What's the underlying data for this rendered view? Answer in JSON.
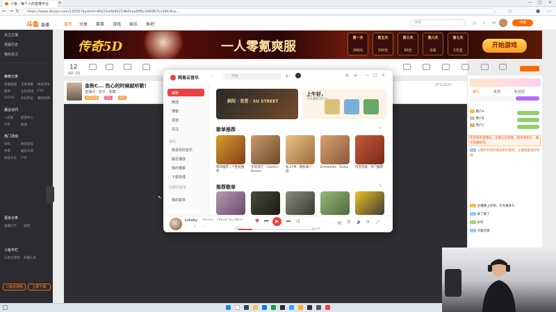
{
  "browser": {
    "tab_title": "斗鱼 - 每个人的直播平台",
    "url": "https://www.douyu.com/12055?dyshid=40d15e0b90214b0cea5ff5c3d00671c3dfc9ca..."
  },
  "site": {
    "logo": "斗鱼",
    "logo_sub": "直播",
    "nav": [
      "首页",
      "分类",
      "赛事",
      "游戏",
      "娱乐",
      "鱼吧"
    ],
    "search_placeholder": "搜索",
    "open_live": "开播"
  },
  "sidebar": {
    "top_items": [
      "关注主播",
      "观看历史",
      "我的关注"
    ],
    "sections": [
      {
        "title": "推荐分类",
        "items": [
          "英雄联盟",
          "王者荣耀",
          "绝地求生",
          "原神",
          "主机游戏",
          "CS2",
          "DOTA2",
          "炉石传说",
          "我的世界"
        ]
      },
      {
        "title": "最近访问",
        "items": [
          "一起看",
          "新游中心",
          "户外",
          "颜值"
        ]
      },
      {
        "title": "热门活动",
        "items": [
          "单机",
          "网游竞技",
          "手游",
          "娱乐天地",
          "科技文化",
          "户外"
        ]
      },
      {
        "title": "更多分类",
        "items": [
          "直播大厅",
          "鱼吧"
        ]
      },
      {
        "title": "斗鱼专栏",
        "items": [
          "斗鱼云游戏",
          "开播工具"
        ]
      }
    ],
    "bottom_left": "斗鱼云游戏",
    "bottom_right": "立即下载"
  },
  "banner": {
    "left_text": "传奇5D",
    "center_text": "一人零氪爽服",
    "days": [
      {
        "day": "第一天",
        "reward": "200元"
      },
      {
        "day": "第五天",
        "reward": "330元"
      },
      {
        "day": "第三天",
        "reward": "50元"
      },
      {
        "day": "第六天",
        "reward": "马车"
      },
      {
        "day": "第七天",
        "reward": "1元宝"
      }
    ],
    "cta": "开始游戏"
  },
  "catrow": {
    "date": "12",
    "date_label": "周四 日签"
  },
  "stream": {
    "title": "金秋C... 伤心的时候就听歌！",
    "streamer": "直播间 · 音乐 · 收藏",
    "tags": [
      "新秀主播",
      "音乐",
      "情感"
    ],
    "viewer_count": "272/1027"
  },
  "right_panel": {
    "tabs": [
      "排行",
      "贵宾",
      "粉丝团"
    ],
    "ranks": [
      "用户A",
      "用户B",
      "用户C"
    ],
    "highlight": "欢迎来到直播间，主播正在听歌，请文明发言，遵守直播规范。",
    "messages": [
      "心情不好的时候就来听歌吧，主播唱歌很好听呀",
      "主播晚上好呀，今天播多久",
      "来了来了",
      "好听",
      "点歌点歌"
    ]
  },
  "music": {
    "app_name": "网易云音乐",
    "search_placeholder": "搜索",
    "nav": [
      "推荐",
      "精选",
      "博客",
      "漫游",
      "关注"
    ],
    "my_section": "我的",
    "my_items": [
      "我喜欢的音乐",
      "最近播放",
      "我的播客",
      "下载管理"
    ],
    "playlist_section": "创建的歌单",
    "playlist_item": "我的歌单",
    "banner_text": "斜阳 · 若是 · SU STREET",
    "banner2_title": "上午好，",
    "banner2_sub": "今天想听点什么",
    "section1": "歌单推荐",
    "cards": [
      "每日推荐 | 个性化推荐",
      "华语流行 · Catchin Dream",
      "私人FM · 随机来一首",
      "Dreamlike · Today",
      "抖音热歌 · 热门推荐"
    ],
    "section2": "推荐歌单",
    "player": {
      "song": "Lullaby",
      "artist": "Various · I Knew You Were",
      "time_current": "00:31",
      "time_total": "03:28",
      "progress": 0.18
    }
  },
  "colors": {
    "accent": "#ff6a00",
    "netease_red": "#ec4141",
    "sidebar_bg": "#2b2b30"
  }
}
